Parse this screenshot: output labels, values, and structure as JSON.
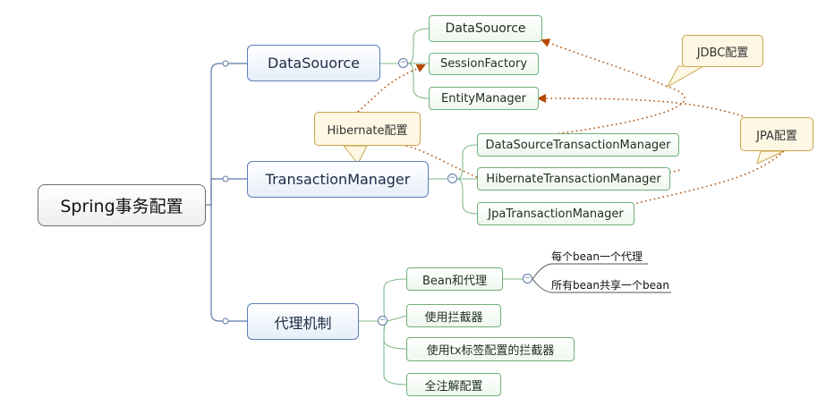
{
  "root": {
    "label": "Spring事务配置"
  },
  "branches": {
    "datasource": {
      "label": "DataSouorce"
    },
    "transaction_manager": {
      "label": "TransactionManager"
    },
    "proxy": {
      "label": "代理机制"
    }
  },
  "datasource_children": [
    "DataSouorce",
    "SessionFactory",
    "EntityManager"
  ],
  "tm_children": [
    "DataSourceTransactionManager",
    "HibernateTransactionManager",
    "JpaTransactionManager"
  ],
  "proxy_children": [
    "Bean和代理",
    "使用拦截器",
    "使用tx标签配置的拦截器",
    "全注解配置"
  ],
  "bean_proxy_children": [
    "每个bean一个代理",
    "所有bean共享一个bean"
  ],
  "callouts": {
    "jdbc": "JDBC配置",
    "hibernate": "Hibernate配置",
    "jpa": "JPA配置"
  },
  "toggle_symbol": "−",
  "colors": {
    "branch_line": "#5e78a6",
    "leaf_line": "#7fb98a",
    "relation": "#b34a00",
    "callout_border": "#c9a64b"
  }
}
